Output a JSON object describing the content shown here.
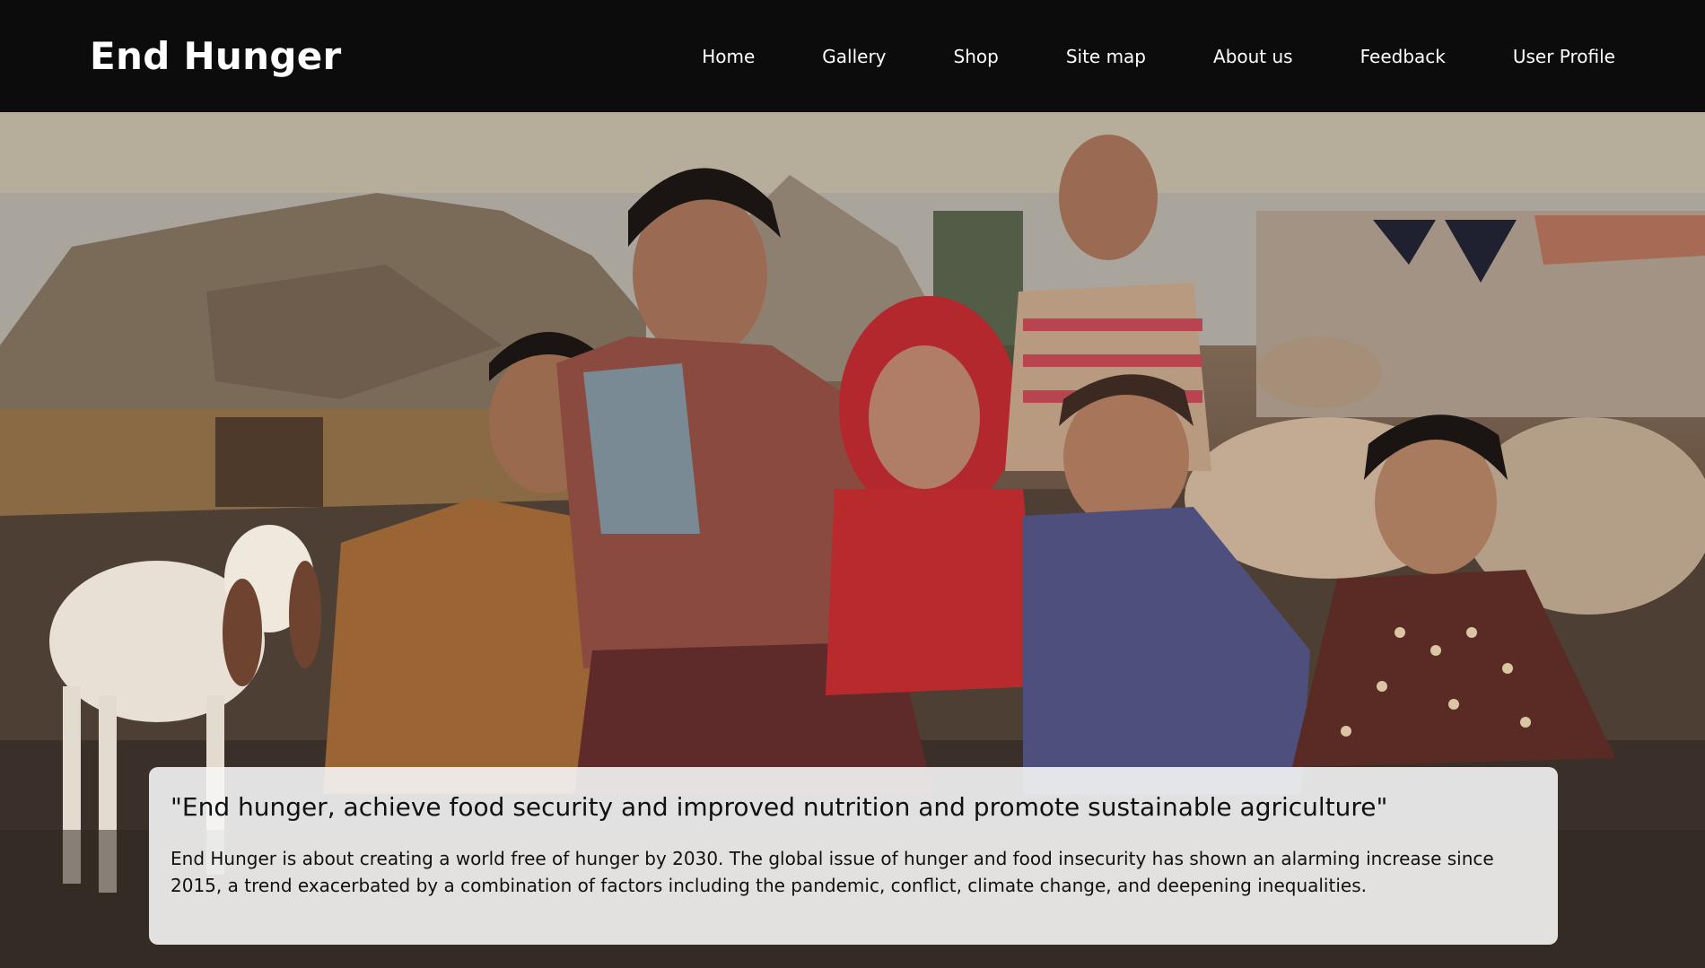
{
  "header": {
    "brand": "End Hunger",
    "nav": [
      {
        "label": "Home"
      },
      {
        "label": "Gallery"
      },
      {
        "label": "Shop"
      },
      {
        "label": "Site map"
      },
      {
        "label": "About us"
      },
      {
        "label": "Feedback"
      },
      {
        "label": "User Profile"
      }
    ]
  },
  "hero": {
    "quote": "\"End hunger, achieve food security and improved nutrition and promote sustainable agriculture\"",
    "description": "End Hunger is about creating a world free of hunger by 2030. The global issue of hunger and food insecurity has shown an alarming increase since 2015, a trend exacerbated by a combination of factors including the pandemic, conflict, climate change, and deepening inequalities."
  }
}
